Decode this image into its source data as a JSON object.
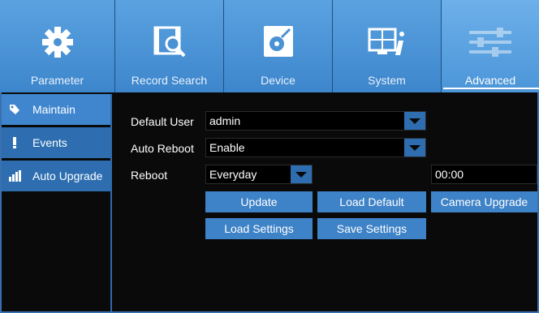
{
  "tabs": [
    {
      "label": "Parameter",
      "icon": "gear-icon"
    },
    {
      "label": "Record Search",
      "icon": "record-search-icon"
    },
    {
      "label": "Device",
      "icon": "device-icon"
    },
    {
      "label": "System",
      "icon": "system-icon"
    },
    {
      "label": "Advanced",
      "icon": "sliders-icon",
      "active": true
    }
  ],
  "sidebar": {
    "items": [
      {
        "label": "Maintain",
        "icon": "wrench-icon",
        "active": true
      },
      {
        "label": "Events",
        "icon": "exclamation-icon"
      },
      {
        "label": "Auto Upgrade",
        "icon": "signal-bars-icon"
      }
    ]
  },
  "form": {
    "default_user": {
      "label": "Default User",
      "value": "admin"
    },
    "auto_reboot": {
      "label": "Auto Reboot",
      "value": "Enable"
    },
    "reboot": {
      "label": "Reboot",
      "value": "Everyday",
      "time": "00:00"
    }
  },
  "buttons": {
    "update": "Update",
    "load_default": "Load Default",
    "camera_upgrade": "Camera Upgrade",
    "load_settings": "Load Settings",
    "save_settings": "Save Settings"
  },
  "colors": {
    "accent": "#3e82c7",
    "tab": "#3d86cc",
    "background": "#0a0a0a"
  }
}
